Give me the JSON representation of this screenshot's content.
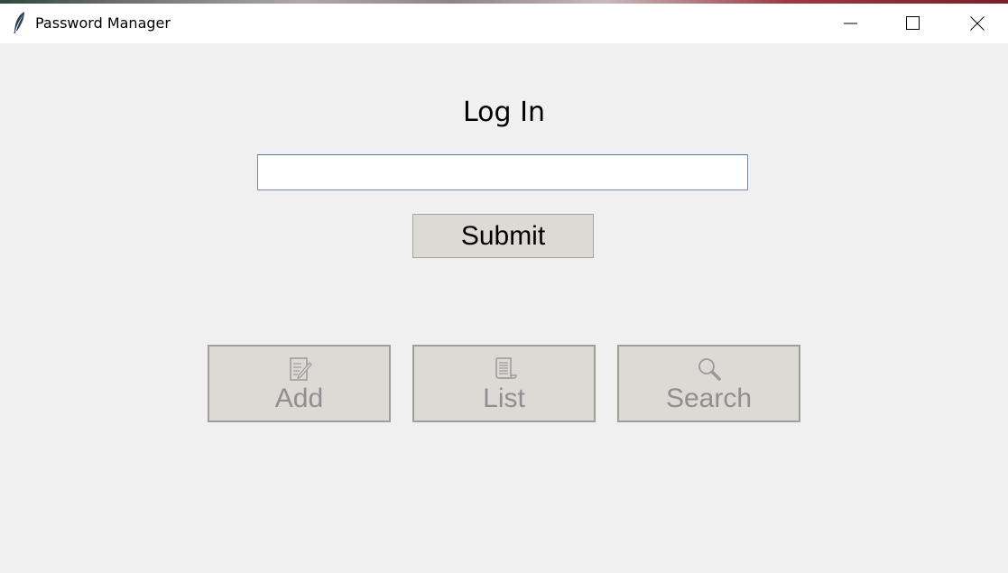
{
  "window": {
    "title": "Password Manager",
    "icon": "feather-icon",
    "controls": {
      "minimize": "minimize-icon",
      "maximize": "maximize-icon",
      "close": "close-icon"
    }
  },
  "login": {
    "title": "Log In",
    "password_value": "",
    "submit_label": "Submit"
  },
  "tools": [
    {
      "label": "Add",
      "icon": "edit-note-icon",
      "enabled": false
    },
    {
      "label": "List",
      "icon": "scroll-list-icon",
      "enabled": false
    },
    {
      "label": "Search",
      "icon": "magnifier-icon",
      "enabled": false
    }
  ],
  "colors": {
    "background": "#f0f0f0",
    "button_face": "#dcdad5",
    "disabled_text": "#8f8f8f",
    "input_border": "#7a8ca8"
  }
}
